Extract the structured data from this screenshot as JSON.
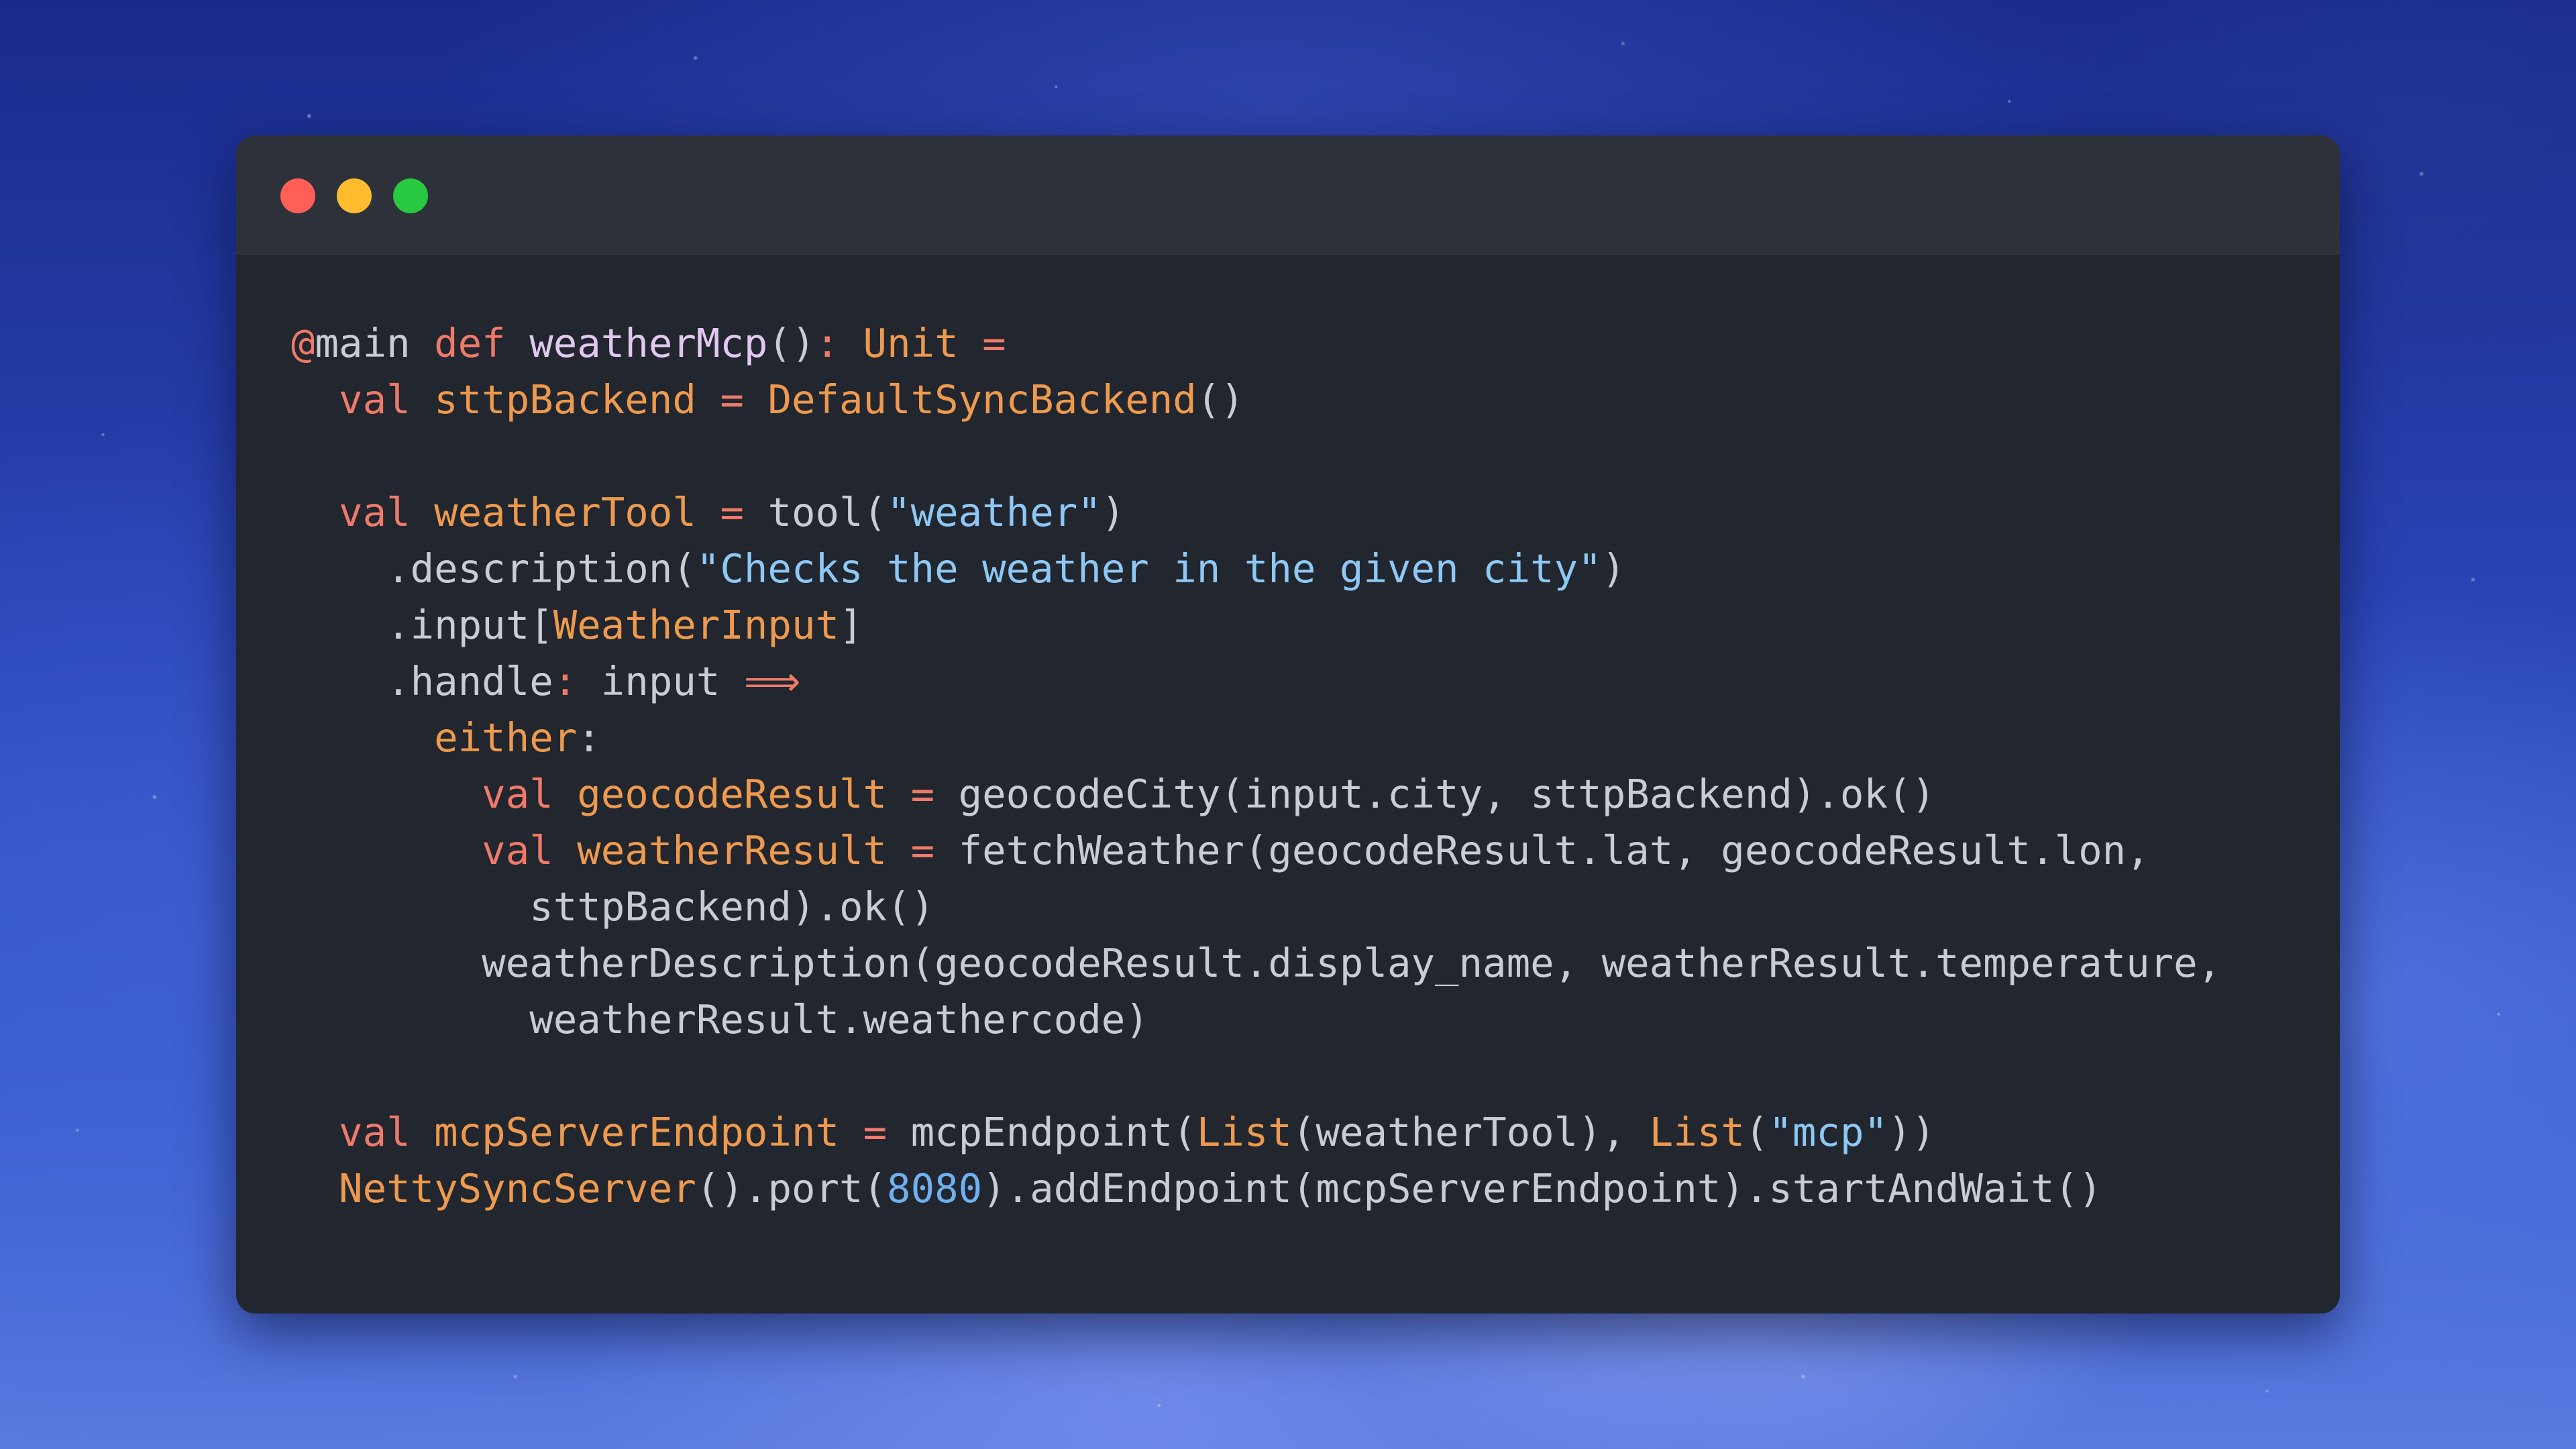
{
  "window": {
    "controls": [
      "close",
      "minimize",
      "maximize"
    ],
    "colors": {
      "close": "#ff5f57",
      "minimize": "#febc2e",
      "maximize": "#28c840",
      "background": "#22262e",
      "titlebar": "#2d3139"
    }
  },
  "code_lines": [
    [
      {
        "t": "annot",
        "s": "@"
      },
      {
        "t": "plain",
        "s": "main "
      },
      {
        "t": "keyword",
        "s": "def "
      },
      {
        "t": "func",
        "s": "weatherMcp"
      },
      {
        "t": "plain",
        "s": "()"
      },
      {
        "t": "punct",
        "s": ": "
      },
      {
        "t": "type",
        "s": "Unit"
      },
      {
        "t": "punct",
        "s": " ="
      }
    ],
    [
      {
        "t": "plain",
        "s": "  "
      },
      {
        "t": "keyword",
        "s": "val "
      },
      {
        "t": "ident",
        "s": "sttpBackend"
      },
      {
        "t": "punct",
        "s": " = "
      },
      {
        "t": "type",
        "s": "DefaultSyncBackend"
      },
      {
        "t": "plain",
        "s": "()"
      }
    ],
    [],
    [
      {
        "t": "plain",
        "s": "  "
      },
      {
        "t": "keyword",
        "s": "val "
      },
      {
        "t": "ident",
        "s": "weatherTool"
      },
      {
        "t": "punct",
        "s": " = "
      },
      {
        "t": "plain",
        "s": "tool("
      },
      {
        "t": "string",
        "s": "\"weather\""
      },
      {
        "t": "plain",
        "s": ")"
      }
    ],
    [
      {
        "t": "plain",
        "s": "    .description("
      },
      {
        "t": "string",
        "s": "\"Checks the weather in the given city\""
      },
      {
        "t": "plain",
        "s": ")"
      }
    ],
    [
      {
        "t": "plain",
        "s": "    .input["
      },
      {
        "t": "type",
        "s": "WeatherInput"
      },
      {
        "t": "plain",
        "s": "]"
      }
    ],
    [
      {
        "t": "plain",
        "s": "    .handle"
      },
      {
        "t": "punct",
        "s": ": "
      },
      {
        "t": "plain",
        "s": "input "
      },
      {
        "t": "punct",
        "s": "⟹"
      }
    ],
    [
      {
        "t": "plain",
        "s": "      "
      },
      {
        "t": "ident",
        "s": "either"
      },
      {
        "t": "plain",
        "s": ":"
      }
    ],
    [
      {
        "t": "plain",
        "s": "        "
      },
      {
        "t": "keyword",
        "s": "val "
      },
      {
        "t": "ident",
        "s": "geocodeResult"
      },
      {
        "t": "punct",
        "s": " = "
      },
      {
        "t": "plain",
        "s": "geocodeCity(input.city, sttpBackend).ok()"
      }
    ],
    [
      {
        "t": "plain",
        "s": "        "
      },
      {
        "t": "keyword",
        "s": "val "
      },
      {
        "t": "ident",
        "s": "weatherResult"
      },
      {
        "t": "punct",
        "s": " = "
      },
      {
        "t": "plain",
        "s": "fetchWeather(geocodeResult.lat, geocodeResult.lon,"
      }
    ],
    [
      {
        "t": "plain",
        "s": "          sttpBackend).ok()"
      }
    ],
    [
      {
        "t": "plain",
        "s": "        weatherDescription(geocodeResult.display_name, weatherResult.temperature,"
      }
    ],
    [
      {
        "t": "plain",
        "s": "          weatherResult.weathercode)"
      }
    ],
    [],
    [
      {
        "t": "plain",
        "s": "  "
      },
      {
        "t": "keyword",
        "s": "val "
      },
      {
        "t": "ident",
        "s": "mcpServerEndpoint"
      },
      {
        "t": "punct",
        "s": " = "
      },
      {
        "t": "plain",
        "s": "mcpEndpoint("
      },
      {
        "t": "type",
        "s": "List"
      },
      {
        "t": "plain",
        "s": "(weatherTool), "
      },
      {
        "t": "type",
        "s": "List"
      },
      {
        "t": "plain",
        "s": "("
      },
      {
        "t": "string",
        "s": "\"mcp\""
      },
      {
        "t": "plain",
        "s": "))"
      }
    ],
    [
      {
        "t": "plain",
        "s": "  "
      },
      {
        "t": "type",
        "s": "NettySyncServer"
      },
      {
        "t": "plain",
        "s": "().port("
      },
      {
        "t": "number",
        "s": "8080"
      },
      {
        "t": "plain",
        "s": ").addEndpoint(mcpServerEndpoint).startAndWait()"
      }
    ]
  ]
}
